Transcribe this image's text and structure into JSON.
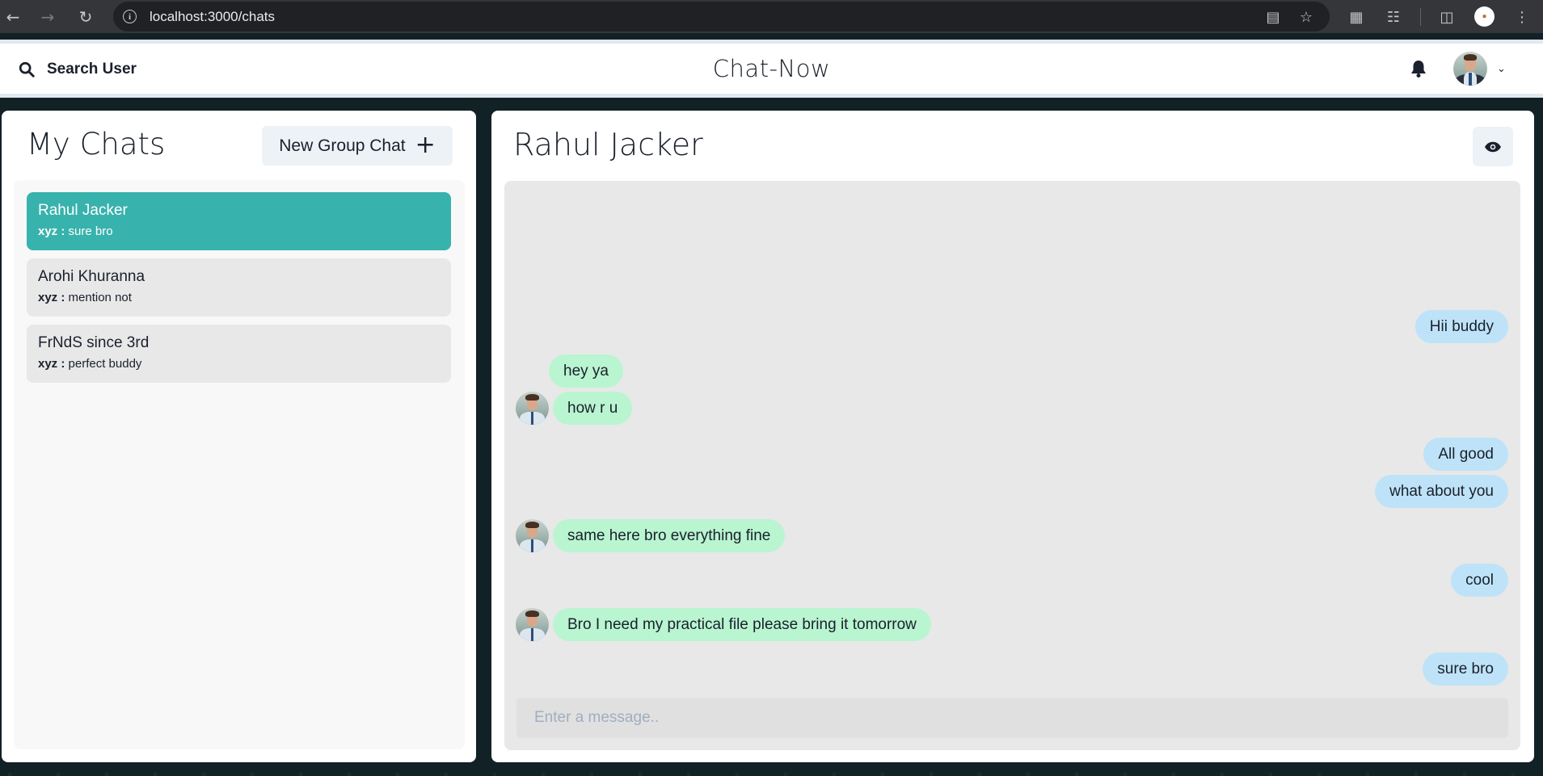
{
  "browser": {
    "url": "localhost:3000/chats"
  },
  "header": {
    "search_label": "Search User",
    "app_title": "Chat-Now"
  },
  "sidebar": {
    "title": "My Chats",
    "new_group_label": "New Group Chat",
    "chats": [
      {
        "name": "Rahul Jacker",
        "sender": "xyz :",
        "latest": "sure bro",
        "active": true
      },
      {
        "name": "Arohi Khuranna",
        "sender": "xyz :",
        "latest": "mention not",
        "active": false
      },
      {
        "name": "FrNdS since 3rd",
        "sender": "xyz :",
        "latest": "perfect buddy",
        "active": false
      }
    ]
  },
  "conversation": {
    "title": "Rahul Jacker",
    "input_placeholder": "Enter a message..",
    "messages": [
      {
        "text": "Hii buddy",
        "from": "me"
      },
      {
        "text": "hey ya",
        "from": "them",
        "avatar": false
      },
      {
        "text": "how r u",
        "from": "them",
        "avatar": true
      },
      {
        "text": "All good",
        "from": "me"
      },
      {
        "text": "what about you",
        "from": "me"
      },
      {
        "text": "same here bro everything fine",
        "from": "them",
        "avatar": true
      },
      {
        "text": "cool",
        "from": "me"
      },
      {
        "text": "Bro I need my practical file please bring it tomorrow",
        "from": "them",
        "avatar": true
      },
      {
        "text": "sure bro",
        "from": "me"
      }
    ]
  },
  "colors": {
    "active_chat": "#38b2ac",
    "my_bubble": "#bee3f8",
    "their_bubble": "#b9f5d0",
    "panel_bg": "#e8e8e8"
  },
  "icons": {
    "search": "search-icon",
    "bell": "bell-icon",
    "eye": "eye-icon",
    "plus": "plus-icon",
    "chevron": "chevron-down-icon"
  }
}
